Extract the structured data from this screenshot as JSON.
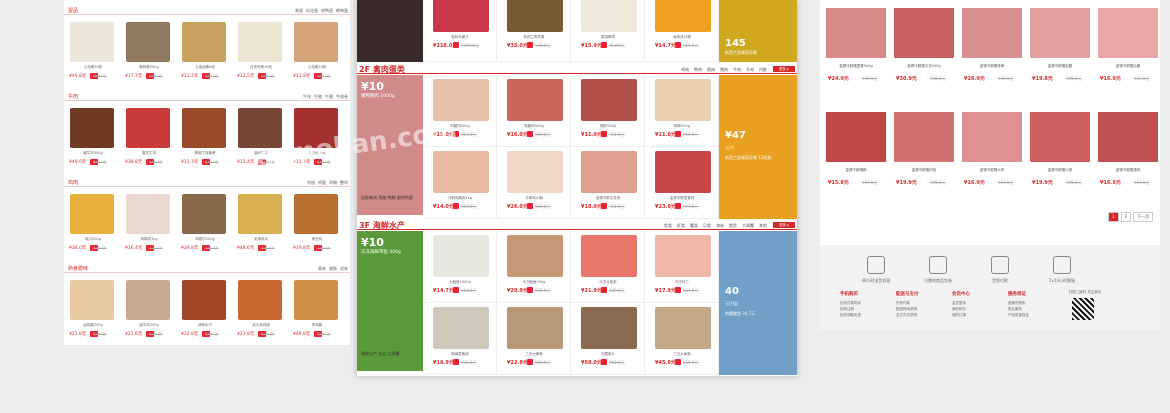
{
  "left": {
    "sections": [
      {
        "title": "蛋品",
        "tags": [
          "禽蛋",
          "松花蛋",
          "咸鸭蛋",
          "鹌鹑蛋"
        ],
        "products": [
          {
            "name": "土鸡蛋30枚",
            "price": "¥49.8元",
            "old": "¥59.0元",
            "color": "#ece5da"
          },
          {
            "name": "鹌鹑蛋500g",
            "price": "¥17.7元",
            "old": "¥23.0元",
            "color": "#8f7a61"
          },
          {
            "name": "五香卤蛋6枚",
            "price": "¥12.2元",
            "old": "¥16.0元",
            "color": "#caa25f"
          },
          {
            "name": "白壳鸡蛋10枚",
            "price": "¥12.5元",
            "old": "¥15.0元",
            "color": "#eee4d2"
          },
          {
            "name": "土鸡蛋10枚",
            "price": "¥11.9元",
            "old": "¥14.0元",
            "color": "#d6a277"
          }
        ]
      },
      {
        "title": "牛肉",
        "tags": [
          "牛排",
          "牛腩",
          "牛腱",
          "牛肉卷"
        ],
        "products": [
          {
            "name": "酱牛肉300g",
            "price": "¥49.0元",
            "old": "¥58.0元",
            "color": "#6e3a24"
          },
          {
            "name": "雪花牛排",
            "price": "¥38.8元",
            "old": "¥45.0元",
            "color": "#c83a3a"
          },
          {
            "name": "黑椒牛排套餐",
            "price": "¥13.7元",
            "old": "¥19.0元",
            "color": "#9a4a2a"
          },
          {
            "name": "澳洲牛腩",
            "price": "¥15.4元",
            "old": "¥19.0元",
            "color": "#7a4634"
          },
          {
            "name": "牛肉块1kg",
            "price": "¥13.7元",
            "old": "¥18.0元",
            "color": "#a53030"
          }
        ]
      },
      {
        "title": "鸡肉",
        "tags": [
          "鸡翅",
          "鸡腿",
          "鸡胸",
          "整鸡"
        ],
        "products": [
          {
            "name": "鸡爪500g",
            "price": "¥38.0元",
            "old": "¥48.0元",
            "color": "#e8b03c"
          },
          {
            "name": "鸡胸肉1kg",
            "price": "¥16.4元",
            "old": "¥21.0元",
            "color": "#e8d8d0"
          },
          {
            "name": "鸡翅中500g",
            "price": "¥29.8元",
            "old": "¥35.0元",
            "color": "#8a6a4a"
          },
          {
            "name": "老母鸡汤",
            "price": "¥48.6元",
            "old": "¥55.0元",
            "color": "#d8b050"
          },
          {
            "name": "烤全鸡",
            "price": "¥19.8元",
            "old": "¥25.0元",
            "color": "#b87030"
          }
        ]
      },
      {
        "title": "熟食腊味",
        "tags": [
          "熏肉",
          "腊肠",
          "卤味"
        ],
        "products": [
          {
            "name": "卤鸡腿300g",
            "price": "¥21.8元",
            "old": "¥28.0元",
            "color": "#e8c8a0"
          },
          {
            "name": "卤牛肉300g",
            "price": "¥21.6元",
            "old": "¥28.0元",
            "color": "#c8a890"
          },
          {
            "name": "烤鸭半只",
            "price": "¥32.8元",
            "old": "¥39.0元",
            "color": "#a04828"
          },
          {
            "name": "奥尔良鸡翅",
            "price": "¥21.8元",
            "old": "¥28.0元",
            "color": "#c86830"
          },
          {
            "name": "熏鸡腿",
            "price": "¥49.8元",
            "old": "¥58.0元",
            "color": "#d09048"
          }
        ]
      }
    ]
  },
  "mid": {
    "top_row": [
      {
        "name": "智利车厘子",
        "price": "¥218.0元",
        "old": "¥249.0元",
        "color": "#c8384a"
      },
      {
        "name": "新西兰奇异果",
        "price": "¥35.0元",
        "old": "¥45.0元",
        "color": "#7a5a30"
      },
      {
        "name": "泰国椰青",
        "price": "¥15.9元",
        "old": "¥19.0元",
        "color": "#f0e8d8"
      },
      {
        "name": "南非进口橙",
        "price": "¥14.7元",
        "old": "¥19.0元",
        "color": "#f0a020"
      }
    ],
    "top_promo": {
      "big": "145",
      "sub": "元",
      "txt": "新西兰金果奇异果",
      "color": "#d0a820"
    },
    "floors": [
      {
        "title": "2F 禽肉蛋类",
        "tags": [
          "鸡肉",
          "鸭肉",
          "鹅肉",
          "猪肉",
          "牛肉",
          "羊肉",
          "内脏"
        ],
        "more": "更多 ▸",
        "banner": {
          "big": "¥10",
          "sub": "嫩鸭胸肉 1000g",
          "name": "冻鲜禽肉 鸡翅 鸭胸 限时特惠",
          "color": "#d08a8a"
        },
        "promo": {
          "big": "¥47",
          "sub": "元/只",
          "txt": "新西兰金果奇异果 12粒装",
          "color": "#e8a020"
        },
        "items": [
          {
            "name": "鸭腿肉500g",
            "price": "¥15.0元",
            "old": "¥19.0元",
            "color": "#e8c0a8"
          },
          {
            "name": "鸭胸肉500g",
            "price": "¥16.0元",
            "old": "¥20.0元",
            "color": "#c8685a"
          },
          {
            "name": "鸭胗500g",
            "price": "¥11.0元",
            "old": "¥15.0元",
            "color": "#b05048"
          },
          {
            "name": "鸭掌500g",
            "price": "¥11.0元",
            "old": "¥15.0元",
            "color": "#e8d0b0"
          },
          {
            "name": "冷鲜鸡胸肉1kg",
            "price": "¥14.0元",
            "old": "¥18.0元",
            "color": "#e8b8a0"
          },
          {
            "name": "冷鲜鸡小胸",
            "price": "¥26.0元",
            "old": "¥32.0元",
            "color": "#f0d8c8"
          },
          {
            "name": "金锣冷鲜五花肉",
            "price": "¥18.0元",
            "old": "¥24.0元",
            "color": "#e0a090"
          },
          {
            "name": "金锣冷鲜里脊肉",
            "price": "¥23.0元",
            "old": "¥27.0元",
            "color": "#c84848"
          }
        ]
      },
      {
        "title": "3F 海鲜水产",
        "tags": [
          "鱼类",
          "虾类",
          "蟹类",
          "贝类",
          "海参",
          "鱿鱼",
          "大闸蟹",
          "其他"
        ],
        "more": "更多 ▸",
        "banner": {
          "big": "¥10",
          "sub": "冻冻海鲜带鱼 400g",
          "name": "海鲜水产 冻品 大闸蟹",
          "color": "#5a9a3a"
        },
        "promo": {
          "big": "40",
          "sub": "元/只起",
          "txt": "特惠鱿鱼 34.7元",
          "color": "#70a0c8"
        },
        "items": [
          {
            "name": "大鱿鱼1000g",
            "price": "¥14.7元",
            "old": "¥18.0元",
            "color": "#e8e8e0"
          },
          {
            "name": "冷冻鱿鱼500g",
            "price": "¥29.9元",
            "old": "¥35.0元",
            "color": "#c89878"
          },
          {
            "name": "冷冻北极虾",
            "price": "¥21.9元",
            "old": "¥28.0元",
            "color": "#e8786a"
          },
          {
            "name": "冷冻虾仁",
            "price": "¥17.9元",
            "old": "¥24.0元",
            "color": "#f0b8a8"
          },
          {
            "name": "挪威带鱼段",
            "price": "¥16.9元",
            "old": "¥22.0元",
            "color": "#d0c8b8"
          },
          {
            "name": "三去大黄鱼",
            "price": "¥22.8元",
            "old": "¥28.0元",
            "color": "#b89878"
          },
          {
            "name": "冻鳗鱼片",
            "price": "¥59.0元",
            "old": "¥68.0元",
            "color": "#8a6a50"
          },
          {
            "name": "三去大黄鱼",
            "price": "¥45.0元",
            "old": "¥55.0元",
            "color": "#c0a888"
          }
        ]
      }
    ]
  },
  "right": {
    "row1": [
      {
        "name": "金锣冷鲜猪里脊500g",
        "price": "¥24.9元",
        "old": "¥30.0元",
        "color": "#d88888"
      },
      {
        "name": "金锣冷鲜猪五花500g",
        "price": "¥30.9元",
        "old": "¥36.0元",
        "color": "#c86060"
      },
      {
        "name": "金锣冷鲜猪排骨",
        "price": "¥26.9元",
        "old": "¥32.0元",
        "color": "#d89090"
      },
      {
        "name": "金锣冷鲜猪前腿",
        "price": "¥19.8元",
        "old": "¥25.0元",
        "color": "#e0a0a0"
      },
      {
        "name": "金锣冷鲜猪后腿",
        "price": "¥16.9元",
        "old": "¥22.0元",
        "color": "#e8a8a8"
      }
    ],
    "row2": [
      {
        "name": "金锣冷鲜猪蹄",
        "price": "¥15.8元",
        "old": "¥19.0元",
        "color": "#c04848"
      },
      {
        "name": "金锣冷鲜猪肉馅",
        "price": "¥19.9元",
        "old": "¥25.0元",
        "color": "#d07070"
      },
      {
        "name": "金锣冷鲜猪大排",
        "price": "¥16.9元",
        "old": "¥21.0元",
        "color": "#e09090"
      },
      {
        "name": "金锣冷鲜猪小排",
        "price": "¥19.9元",
        "old": "¥25.0元",
        "color": "#d06060"
      },
      {
        "name": "金锣冷鲜猪颈肉",
        "price": "¥16.5元",
        "old": "¥21.0元",
        "color": "#c05050"
      }
    ],
    "pager": {
      "p1": "1",
      "p2": "2",
      "next": "下一页"
    },
    "services": [
      "48小时送货到家",
      "可靠的商品包装",
      "货到付款",
      "7x13小时客服"
    ],
    "footer": [
      {
        "h": "手机购买",
        "items": [
          "如何付款购买",
          "如何注册",
          "如何领取优惠"
        ]
      },
      {
        "h": "配送与支付",
        "items": [
          "货到付款",
          "配送时间说明",
          "支付方式说明"
        ]
      },
      {
        "h": "会员中心",
        "items": [
          "会员登录",
          "我的积分",
          "我的订单"
        ]
      },
      {
        "h": "服务保证",
        "items": [
          "退换货原则",
          "售后服务",
          "产品质量保证"
        ]
      }
    ],
    "qr_label": "扫描二维码 关注我们"
  },
  "watermark": "ecmoban.com"
}
